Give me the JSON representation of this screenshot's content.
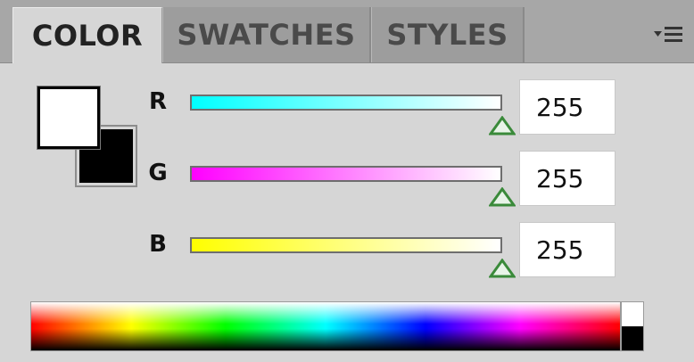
{
  "tabs": [
    {
      "label": "COLOR",
      "active": true
    },
    {
      "label": "SWATCHES",
      "active": false
    },
    {
      "label": "STYLES",
      "active": false
    }
  ],
  "menu_icon": "panel-menu-icon",
  "swatches": {
    "foreground_color": "#ffffff",
    "background_color": "#000000"
  },
  "channels": [
    {
      "label": "R",
      "value": "255",
      "level": 1.0,
      "gradient_start": "#00ffff"
    },
    {
      "label": "G",
      "value": "255",
      "level": 1.0,
      "gradient_start": "#ff00ff"
    },
    {
      "label": "B",
      "value": "255",
      "level": 1.0,
      "gradient_start": "#ffff00"
    }
  ]
}
